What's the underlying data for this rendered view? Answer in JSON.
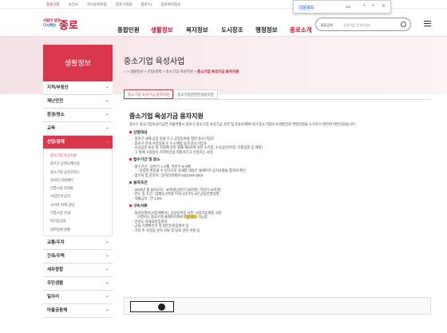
{
  "topbar": {
    "links": [
      "종로구청",
      "보건소",
      "역사문화관광",
      "종로구의회",
      "종로TV",
      "종로복지정보"
    ]
  },
  "findbar": {
    "query": "다운로드",
    "count": "1/1",
    "up": "˄",
    "down": "˅",
    "close": "✕"
  },
  "logo": {
    "line1": "사람이 살맛",
    "line2": "다시뛰는",
    "name": "종로"
  },
  "gnb": [
    "종합민원",
    "생활정보",
    "복지정보",
    "도시창조",
    "행정정보",
    "종로소개"
  ],
  "gnb_active": "생활정보",
  "search": {
    "select": "통합검색",
    "placeholder": "검색어를 입력하세요"
  },
  "sidebar": {
    "title": "생활정보",
    "items": [
      "지적/부동산",
      "재난안전",
      "환경/청소",
      "교육",
      "산업/경제",
      "교통/주차",
      "건축/주택",
      "세무종합",
      "주민생활",
      "일자리",
      "마을공동체"
    ],
    "sub": [
      "중소기업 육성지원",
      "종로구 공영도매시장",
      "중소기업 공유오피스",
      "일자리 지원센터",
      "전통시장 현대화",
      "사업안내 공지",
      "소비자 피해 상담",
      "전통시장 안내",
      "복지공급용",
      "대부업체 현황"
    ]
  },
  "page": {
    "title": "중소기업 육성사업",
    "crumb": [
      "생활정보",
      "산업/경제",
      "중소기업 육성지원",
      "중소기업 육성기금 융자지원"
    ],
    "tabs": [
      "중소기업 육성기금 융자지원",
      "중소기업경영컨설팅지원"
    ],
    "h2": "중소기업 육성기금 융자지원",
    "intro": "종로구 중소기업육성기금은 서울특별시 종로구 중소기업 육성기금 설치 및 운용조례에 의거 중소기업의 육성발전과 경영안정을 도모하기 위하여 마련되었습니다.",
    "sec1": "신청대상",
    "sec1_items": [
      "- 종로구 내에 공장 등을 두고 공장등록을 필한 중소기업자",
      "- 종로구 관내 사업장을 둔 도소매업 등의 중소기업자",
      "- 소상공인 보호 및 지원에 관한 법률 제2조에 의한 소기업, 소상공인(주점, 유흥업종 등 제외)",
      "- 그 밖에 구청장이 지역여건상 적합하다고 인정하는 사업"
    ],
    "sec2": "접수기간 및 장소",
    "sec2_items": [
      "- 접수기간 : 상반기 1~2월, 하반기 8~9월",
      "- 일정한 변동될 수 있으므로 자세한 내용은 홈페이지 공지사항을 통하여 확인",
      "- 접수처 및 문의처 : 일자리경제과 02)2148-2263"
    ],
    "sec3": "융자조건",
    "sec3_items": [
      "- 2023년 총 융자규모 : 40억원(상반기 29억원, 하반기 11억원)",
      "- 한도 및 조건 : 업체당 2억원 이내 1년거치 4년 균등분할상환",
      "- 대출금리 : 연 1.5%"
    ],
    "sec4": "구비서류",
    "sec4_items": [
      "- 융자신청서(사업계획서), 공장등록증 사본, 사업자등록증 사본",
      "  신청서는 종로구청 홈페이지에서",
      "다운로드",
      "가능함",
      "- 전년도 과세표준증명서",
      "- 금융 거래확인서 및 법인인감증명서 등",
      "- 기타 주 사업장 관련 서류 및 담보 관련 서류 등"
    ],
    "footer": {
      "open": "OPEN",
      "text": "본 저작물은 공공누리 제1유형 출처표시 조건에 따라 이용할 수 있습니다."
    }
  }
}
